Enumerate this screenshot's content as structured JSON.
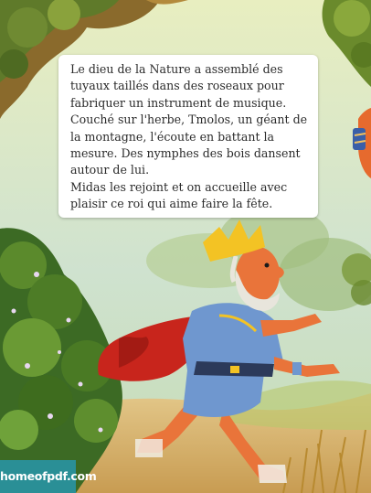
{
  "story": {
    "paragraph_1": " Le dieu de la Nature a assemblé des tuyaux taillés dans des roseaux pour fabriquer un instrument de musique. Couché sur l'herbe, Tmolos, un géant de la montagne, l'écoute en battant la mesure. Des nymphes des bois dansent autour de lui.",
    "paragraph_2": "Midas les rejoint et on accueille avec plaisir ce roi qui aime faire la fête."
  },
  "watermark": {
    "label": "homeofpdf.com"
  },
  "colors": {
    "sky": "#cfe3cf",
    "ground": "#d8b874",
    "cape": "#c8251c",
    "tunic": "#6f97cf",
    "skin": "#e9743a",
    "crown": "#f3c324",
    "badge": "#2a8f96"
  }
}
